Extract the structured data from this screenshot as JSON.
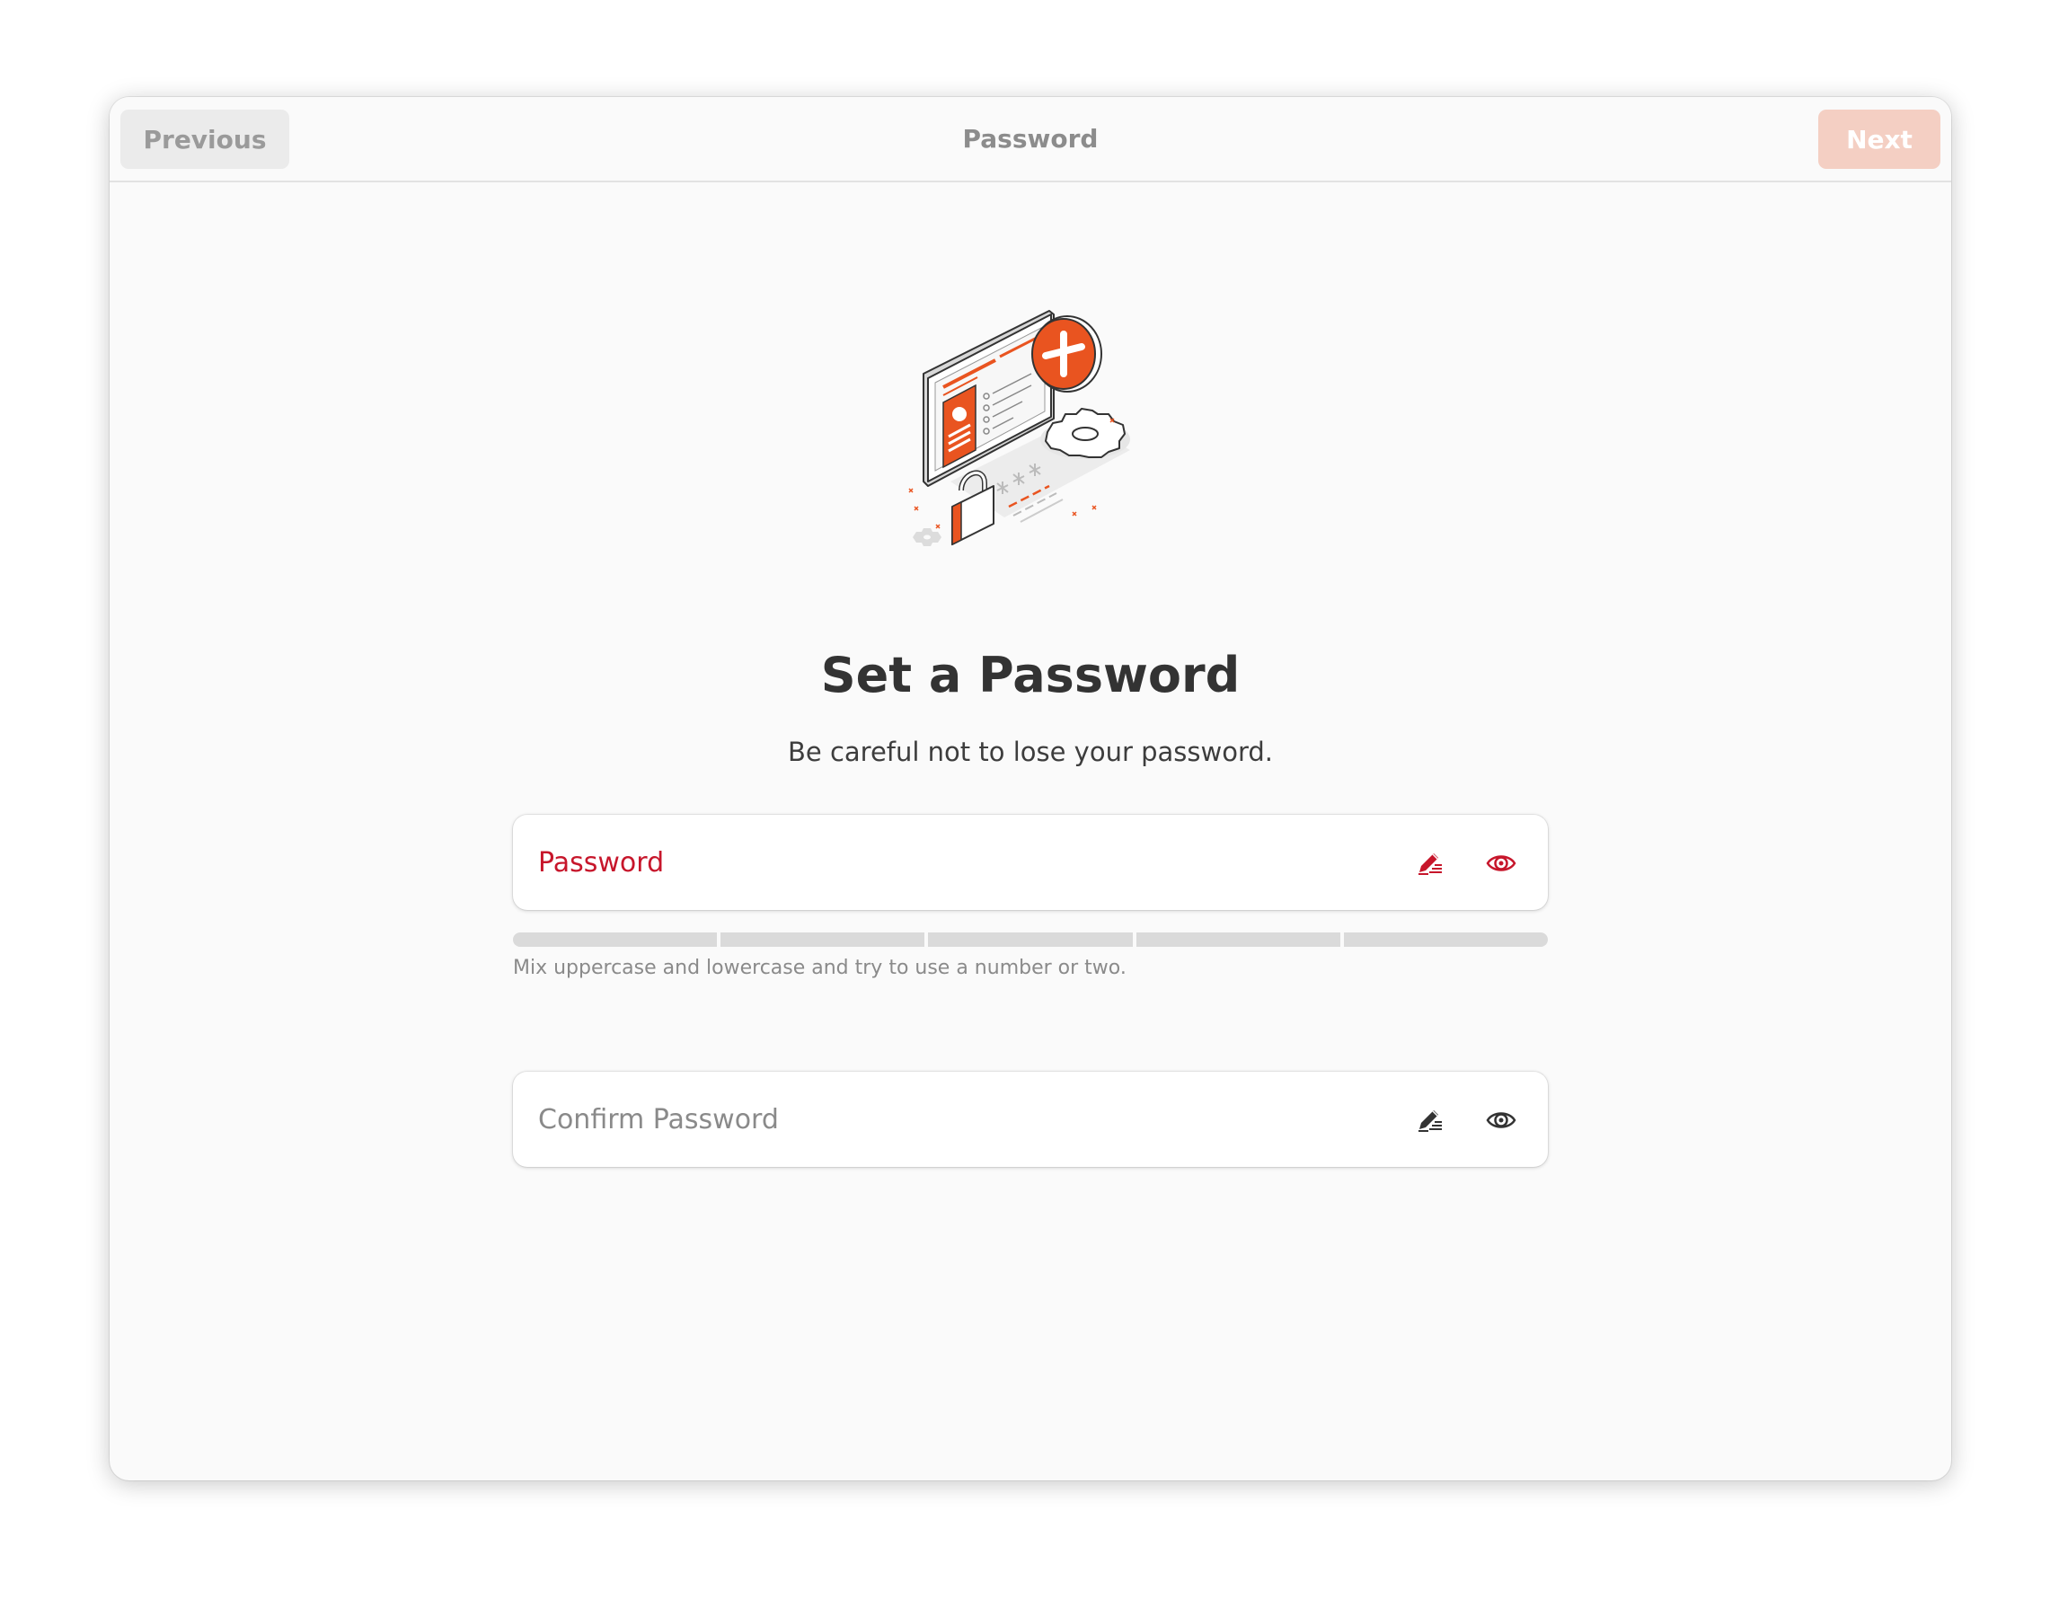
{
  "header": {
    "title": "Password",
    "previous_label": "Previous",
    "next_label": "Next"
  },
  "main": {
    "illustration": "password-illustration",
    "title": "Set a Password",
    "subtitle": "Be careful not to lose your password."
  },
  "password_field": {
    "placeholder": "Password",
    "value": "",
    "edit_icon": "pencil-generate-icon",
    "reveal_icon": "eye-icon",
    "strength_segments": 5,
    "strength_filled": 0,
    "hint": "Mix uppercase and lowercase and try to use a number or two."
  },
  "confirm_field": {
    "placeholder": "Confirm Password",
    "value": "",
    "edit_icon": "pencil-generate-icon",
    "reveal_icon": "eye-icon"
  },
  "colors": {
    "accent": "#e95420",
    "error": "#c7162b",
    "next_disabled": "#f4cfc3"
  }
}
